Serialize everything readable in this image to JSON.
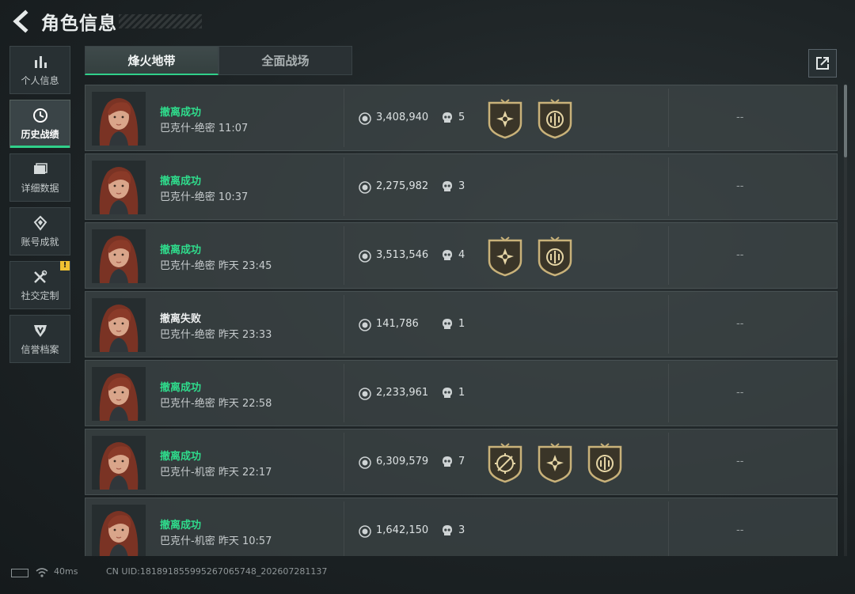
{
  "header": {
    "title": "角色信息"
  },
  "sidebar": {
    "items": [
      {
        "label": "个人信息",
        "icon": "bar-chart-icon"
      },
      {
        "label": "历史战绩",
        "icon": "clock-icon",
        "active": true
      },
      {
        "label": "详细数据",
        "icon": "folder-icon"
      },
      {
        "label": "账号成就",
        "icon": "achievement-icon"
      },
      {
        "label": "社交定制",
        "icon": "tools-icon",
        "badge": "!"
      },
      {
        "label": "信誉档案",
        "icon": "shield-icon"
      }
    ]
  },
  "tabs": [
    {
      "label": "烽火地带",
      "active": true
    },
    {
      "label": "全面战场",
      "active": false
    }
  ],
  "share": {
    "icon": "share-icon"
  },
  "records": [
    {
      "result": "撤离成功",
      "status": "success",
      "map": "巴克什-绝密 11:07",
      "value": "3,408,940",
      "kills": "5",
      "medals": [
        "star-medal",
        "laurel-medal"
      ],
      "extra": "--"
    },
    {
      "result": "撤离成功",
      "status": "success",
      "map": "巴克什-绝密 10:37",
      "value": "2,275,982",
      "kills": "3",
      "medals": [],
      "extra": "--"
    },
    {
      "result": "撤离成功",
      "status": "success",
      "map": "巴克什-绝密 昨天 23:45",
      "value": "3,513,546",
      "kills": "4",
      "medals": [
        "star-medal",
        "laurel-medal"
      ],
      "extra": "--"
    },
    {
      "result": "撤离失败",
      "status": "fail",
      "map": "巴克什-绝密 昨天 23:33",
      "value": "141,786",
      "kills": "1",
      "medals": [],
      "extra": "--"
    },
    {
      "result": "撤离成功",
      "status": "success",
      "map": "巴克什-绝密 昨天 22:58",
      "value": "2,233,961",
      "kills": "1",
      "medals": [],
      "extra": "--"
    },
    {
      "result": "撤离成功",
      "status": "success",
      "map": "巴克什-机密 昨天 22:17",
      "value": "6,309,579",
      "kills": "7",
      "medals": [
        "crosshair-medal",
        "star-medal",
        "laurel-medal"
      ],
      "extra": "--"
    },
    {
      "result": "撤离成功",
      "status": "success",
      "map": "巴克什-机密 昨天 10:57",
      "value": "1,642,150",
      "kills": "3",
      "medals": [],
      "extra": "--"
    }
  ],
  "footer": {
    "ping": "40ms",
    "uid": "CN UID:181891855995267065748_202607281137"
  },
  "colors": {
    "accent": "#30d08a",
    "success": "#2fdc8c",
    "fail": "#eef0f0",
    "badge": "#f1c232",
    "medal_gold": "#c9b27a"
  }
}
